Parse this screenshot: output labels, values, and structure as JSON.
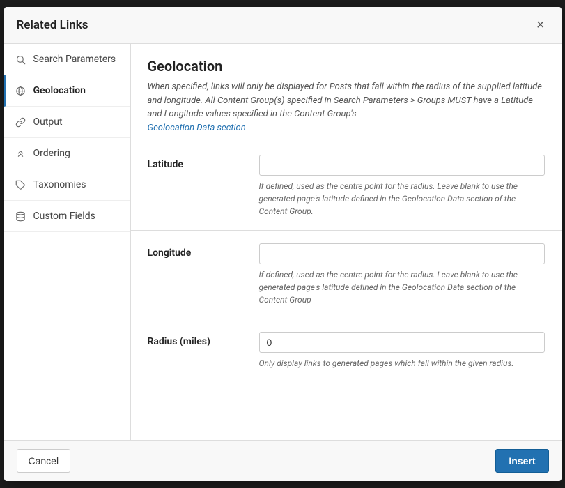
{
  "modal": {
    "title": "Related Links",
    "close_label": "×"
  },
  "sidebar": {
    "items": [
      {
        "id": "search-parameters",
        "label": "Search Parameters",
        "icon": "search",
        "active": false
      },
      {
        "id": "geolocation",
        "label": "Geolocation",
        "icon": "globe",
        "active": true
      },
      {
        "id": "output",
        "label": "Output",
        "icon": "link",
        "active": false
      },
      {
        "id": "ordering",
        "label": "Ordering",
        "icon": "chevrons-up",
        "active": false
      },
      {
        "id": "taxonomies",
        "label": "Taxonomies",
        "icon": "tag",
        "active": false
      },
      {
        "id": "custom-fields",
        "label": "Custom Fields",
        "icon": "database",
        "active": false
      }
    ]
  },
  "content": {
    "title": "Geolocation",
    "description": "When specified, links will only be displayed for Posts that fall within the radius of the supplied latitude and longitude. All Content Group(s) specified in Search Parameters > Groups MUST have a Latitude and Longitude values specified in the Content Group's",
    "link_text": "Geolocation Data section",
    "fields": [
      {
        "id": "latitude",
        "label": "Latitude",
        "value": "",
        "placeholder": "",
        "help": "If defined, used as the centre point for the radius. Leave blank to use the generated page's latitude defined in the Geolocation Data section of the Content Group."
      },
      {
        "id": "longitude",
        "label": "Longitude",
        "value": "",
        "placeholder": "",
        "help": "If defined, used as the centre point for the radius. Leave blank to use the generated page's latitude defined in the Geolocation Data section of the Content Group"
      },
      {
        "id": "radius",
        "label": "Radius (miles)",
        "value": "0",
        "placeholder": "",
        "help": "Only display links to generated pages which fall within the given radius."
      }
    ]
  },
  "footer": {
    "cancel_label": "Cancel",
    "insert_label": "Insert"
  }
}
